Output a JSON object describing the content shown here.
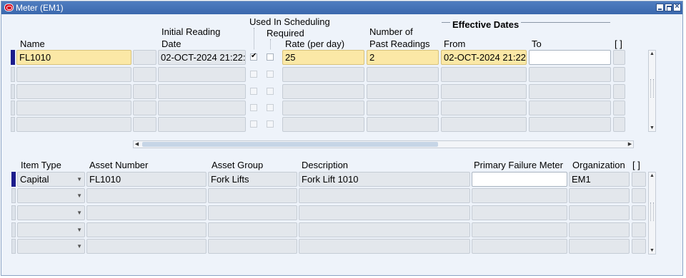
{
  "window": {
    "title": "Meter (EM1)"
  },
  "meters": {
    "headers": {
      "name": "Name",
      "initial_reading_date_1": "Initial Reading",
      "initial_reading_date_2": "Date",
      "used_in_scheduling": "Used In Scheduling",
      "required": "Required",
      "rate": "Rate (per day)",
      "past_readings_1": "Number of",
      "past_readings_2": "Past Readings",
      "effective_dates": "Effective Dates",
      "from": "From",
      "to": "To",
      "folder": "[ ]"
    },
    "rows": [
      {
        "name": "FL1010",
        "initial_date": "02-OCT-2024 21:22:",
        "used_in_scheduling": true,
        "required": false,
        "rate": "25",
        "past_readings": "2",
        "from": "02-OCT-2024 21:22:",
        "to": ""
      }
    ]
  },
  "assets": {
    "headers": {
      "item_type": "Item Type",
      "asset_number": "Asset Number",
      "asset_group": "Asset Group",
      "description": "Description",
      "primary_failure_meter": "Primary Failure Meter",
      "organization": "Organization",
      "folder": "[ ]"
    },
    "rows": [
      {
        "item_type": "Capital",
        "asset_number": "FL1010",
        "asset_group": "Fork Lifts",
        "description": "Fork Lift 1010",
        "primary_failure_meter": "",
        "organization": "EM1"
      }
    ]
  },
  "colors": {
    "titlebar": "#3b68ad",
    "background": "#eef3fa",
    "current_row": "#fbe8a6",
    "row_marker": "#1c1c8c"
  }
}
